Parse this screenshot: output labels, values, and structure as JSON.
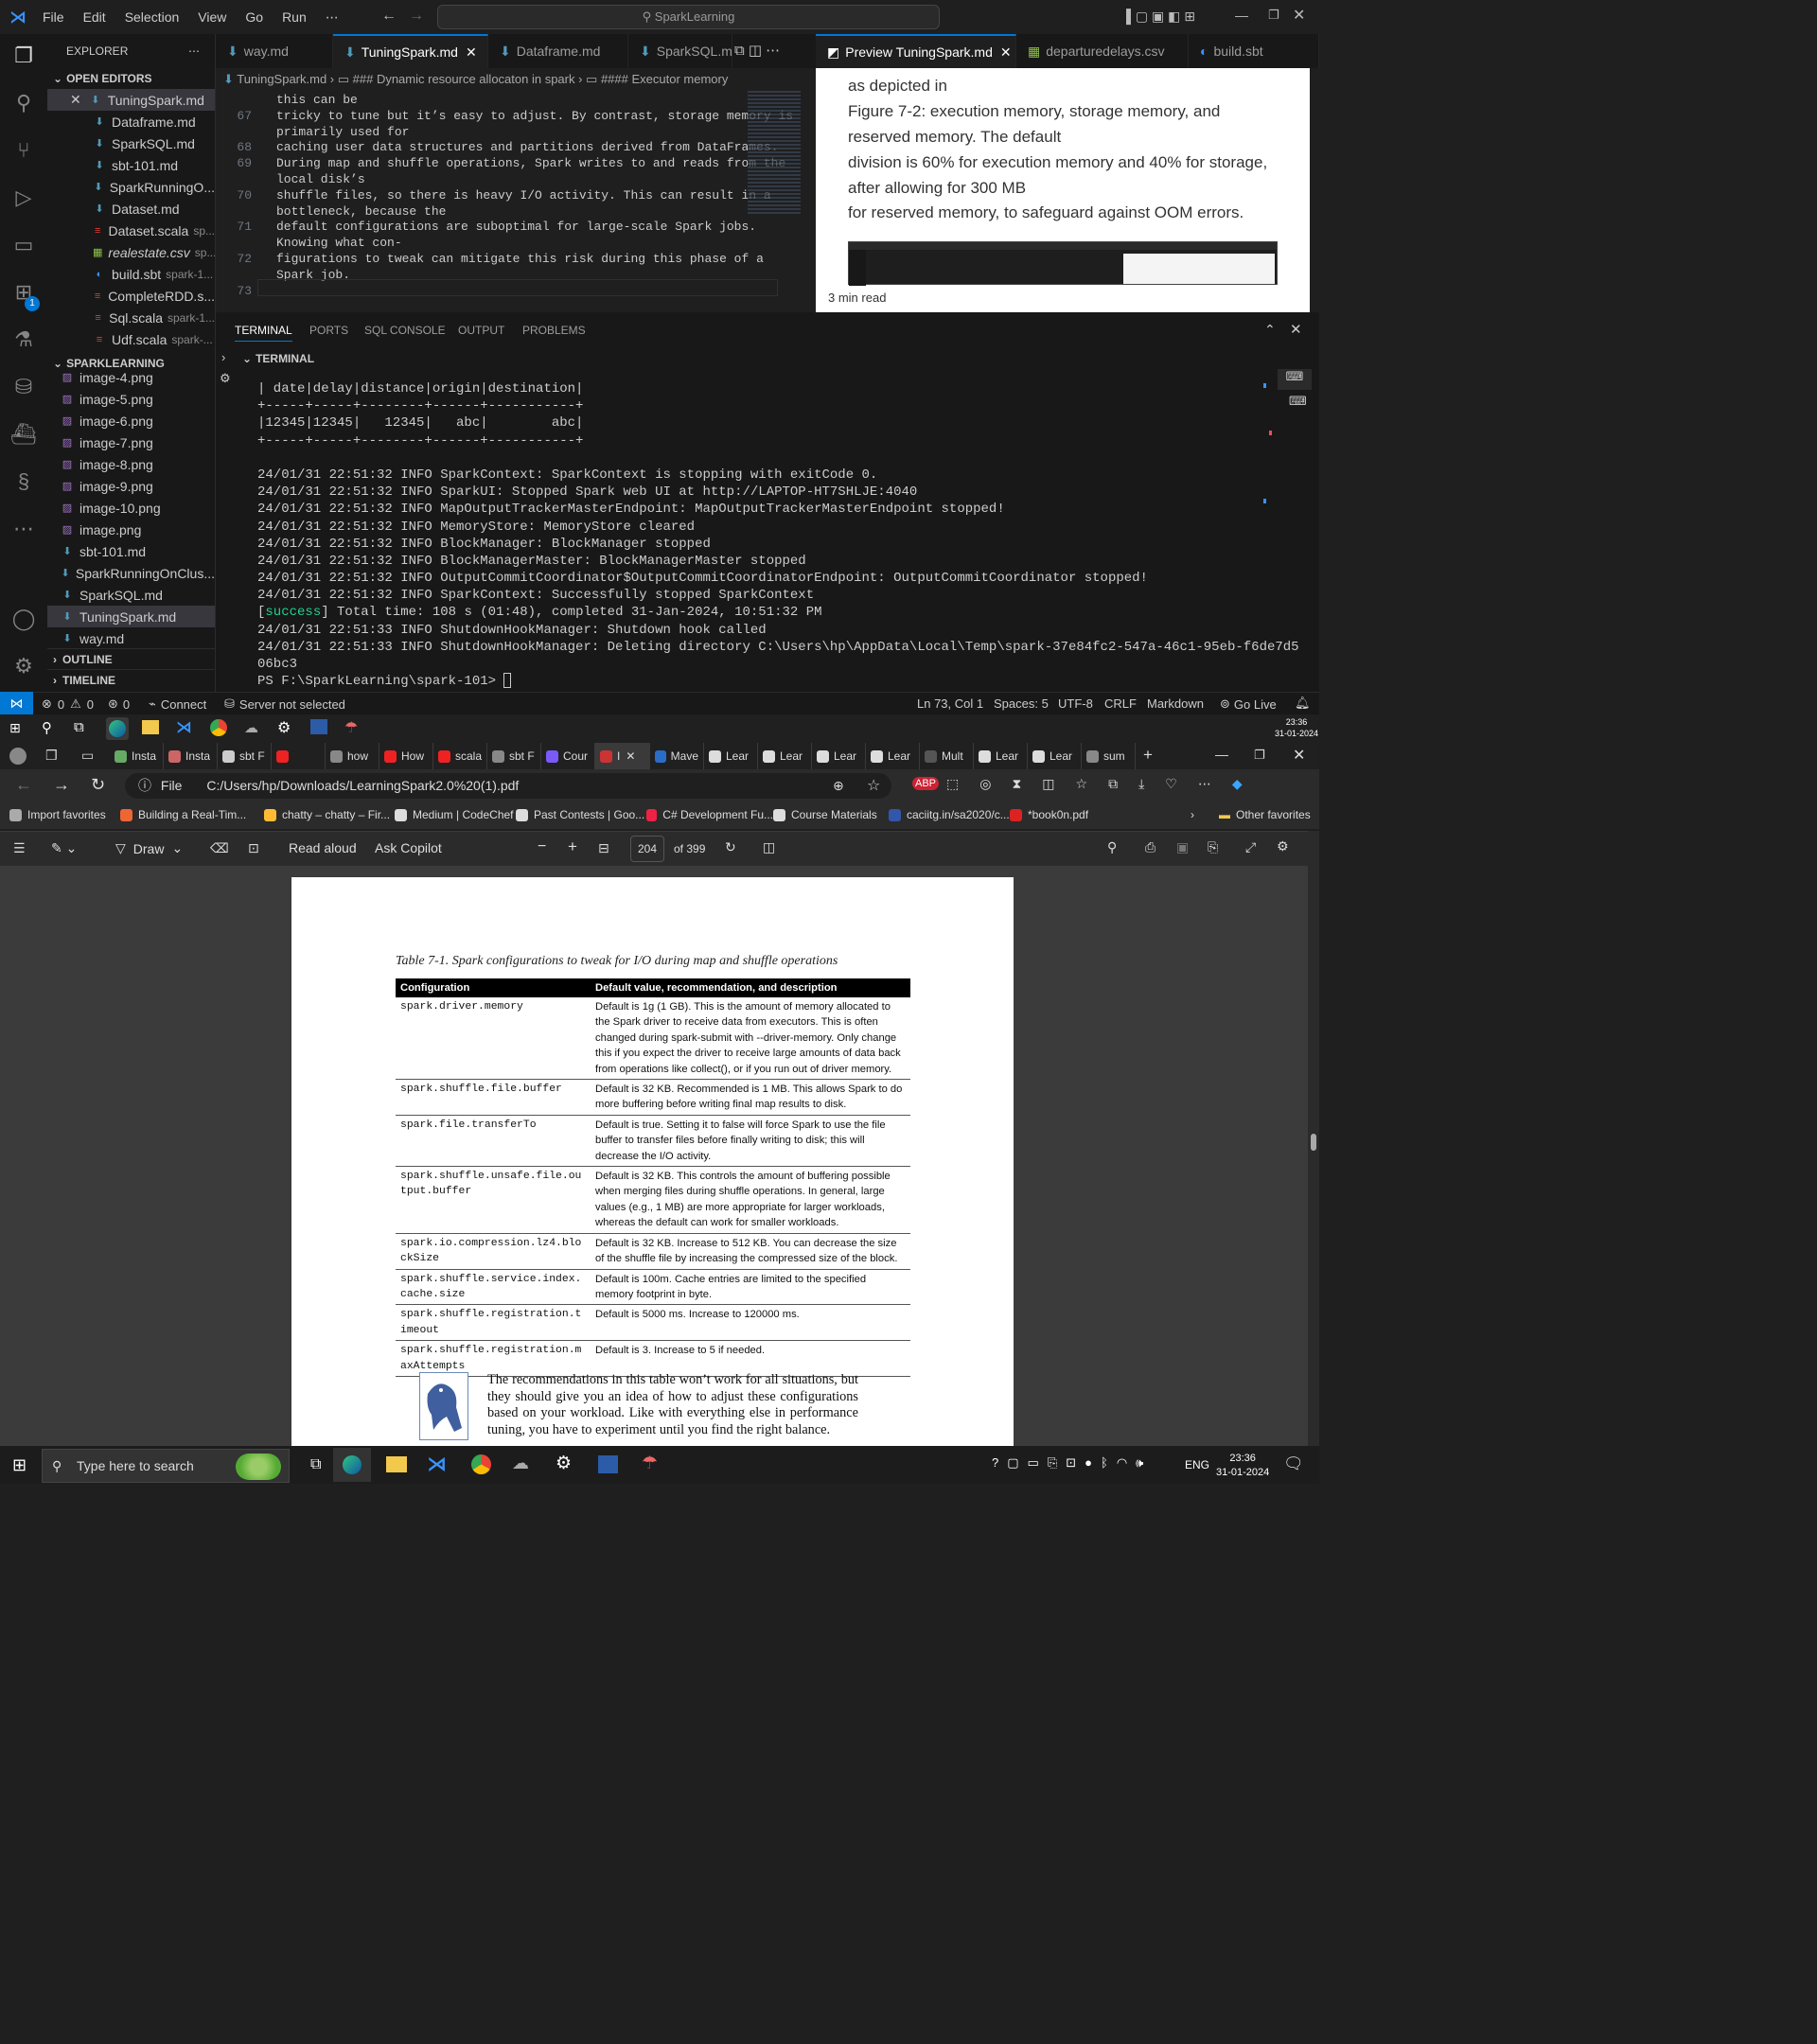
{
  "vscode": {
    "menu": [
      "File",
      "Edit",
      "Selection",
      "View",
      "Go",
      "Run",
      "⋯"
    ],
    "command_center": "SparkLearning",
    "explorer_title": "EXPLORER",
    "open_editors_label": "OPEN EDITORS",
    "open_editors": [
      {
        "name": "TuningSpark.md",
        "sub": "",
        "icon": "md"
      },
      {
        "name": "Dataframe.md",
        "sub": "",
        "icon": "md"
      },
      {
        "name": "SparkSQL.md",
        "sub": "",
        "icon": "md"
      },
      {
        "name": "sbt-101.md",
        "sub": "",
        "icon": "md"
      },
      {
        "name": "SparkRunningO...",
        "sub": "",
        "icon": "md"
      },
      {
        "name": "Dataset.md",
        "sub": "",
        "icon": "md"
      },
      {
        "name": "Dataset.scala",
        "sub": "sp...",
        "icon": "scala"
      },
      {
        "name": "realestate.csv",
        "sub": "sp...",
        "icon": "csv"
      },
      {
        "name": "build.sbt",
        "sub": "spark-1...",
        "icon": "sbt"
      },
      {
        "name": "CompleteRDD.s...",
        "sub": "",
        "icon": "scala"
      },
      {
        "name": "Sql.scala",
        "sub": "spark-1...",
        "icon": "scala"
      },
      {
        "name": "Udf.scala",
        "sub": "spark-...",
        "icon": "scala"
      }
    ],
    "workspace_label": "SPARKLEARNING",
    "files": [
      {
        "name": "image-4.png",
        "icon": "png"
      },
      {
        "name": "image-5.png",
        "icon": "png"
      },
      {
        "name": "image-6.png",
        "icon": "png"
      },
      {
        "name": "image-7.png",
        "icon": "png"
      },
      {
        "name": "image-8.png",
        "icon": "png"
      },
      {
        "name": "image-9.png",
        "icon": "png"
      },
      {
        "name": "image-10.png",
        "icon": "png"
      },
      {
        "name": "image.png",
        "icon": "png"
      },
      {
        "name": "sbt-101.md",
        "icon": "md"
      },
      {
        "name": "SparkRunningOnClus...",
        "icon": "md"
      },
      {
        "name": "SparkSQL.md",
        "icon": "md"
      },
      {
        "name": "TuningSpark.md",
        "icon": "md"
      },
      {
        "name": "way.md",
        "icon": "md"
      }
    ],
    "outline_label": "OUTLINE",
    "timeline_label": "TIMELINE",
    "editor_tabs": [
      "way.md",
      "TuningSpark.md",
      "Dataframe.md",
      "SparkSQL.m"
    ],
    "breadcrumb": [
      "TuningSpark.md",
      "### Dynamic resource allocaton in spark",
      "#### Executor memory"
    ],
    "code_lines": [
      {
        "n": "",
        "t": "this can be"
      },
      {
        "n": "67",
        "t": "tricky to tune but it’s easy to adjust. By contrast, storage memory is"
      },
      {
        "n": "",
        "t": "primarily used for"
      },
      {
        "n": "68",
        "t": "caching user data structures and partitions derived from DataFrames."
      },
      {
        "n": "69",
        "t": "During map and shuffle operations, Spark writes to and reads from the"
      },
      {
        "n": "",
        "t": "local disk’s"
      },
      {
        "n": "70",
        "t": "shuffle files, so there is heavy I/O activity. This can result in a"
      },
      {
        "n": "",
        "t": "bottleneck, because the"
      },
      {
        "n": "71",
        "t": "default configurations are suboptimal for large-scale Spark jobs."
      },
      {
        "n": "",
        "t": "Knowing what con-"
      },
      {
        "n": "72",
        "t": "figurations to tweak can mitigate this risk during this phase of a"
      },
      {
        "n": "",
        "t": "Spark job."
      },
      {
        "n": "73",
        "t": ""
      }
    ],
    "preview_tabs": [
      "Preview TuningSpark.md",
      "departuredelays.csv",
      "build.sbt"
    ],
    "preview_lines": [
      "as depicted in",
      "Figure 7-2: execution memory, storage memory, and",
      "reserved memory. The default",
      "division is 60% for execution memory and 40% for storage,",
      "after allowing for 300 MB",
      "for reserved memory, to safeguard against OOM errors."
    ],
    "preview_read": "3 min read",
    "panel_tabs": [
      "TERMINAL",
      "PORTS",
      "SQL CONSOLE",
      "OUTPUT",
      "PROBLEMS"
    ],
    "terminal_label": "TERMINAL",
    "terminal_lines": [
      "| date|delay|distance|origin|destination|",
      "+-----+-----+--------+------+-----------+",
      "|12345|12345|   12345|   abc|        abc|",
      "+-----+-----+--------+------+-----------+",
      "",
      "24/01/31 22:51:32 INFO SparkContext: SparkContext is stopping with exitCode 0.",
      "24/01/31 22:51:32 INFO SparkUI: Stopped Spark web UI at http://LAPTOP-HT7SHLJE:4040",
      "24/01/31 22:51:32 INFO MapOutputTrackerMasterEndpoint: MapOutputTrackerMasterEndpoint stopped!",
      "24/01/31 22:51:32 INFO MemoryStore: MemoryStore cleared",
      "24/01/31 22:51:32 INFO BlockManager: BlockManager stopped",
      "24/01/31 22:51:32 INFO BlockManagerMaster: BlockManagerMaster stopped",
      "24/01/31 22:51:32 INFO OutputCommitCoordinator$OutputCommitCoordinatorEndpoint: OutputCommitCoordinator stopped!",
      "24/01/31 22:51:32 INFO SparkContext: Successfully stopped SparkContext"
    ],
    "success_word": "success",
    "success_rest": "] Total time: 108 s (01:48), completed 31-Jan-2024, 10:51:32 PM",
    "terminal_tail": [
      "24/01/31 22:51:33 INFO ShutdownHookManager: Shutdown hook called",
      "24/01/31 22:51:33 INFO ShutdownHookManager: Deleting directory C:\\Users\\hp\\AppData\\Local\\Temp\\spark-37e84fc2-547a-46c1-95eb-f6de7d5",
      "06bc3",
      "PS F:\\SparkLearning\\spark-101> "
    ],
    "status": {
      "errors": "0",
      "warnings": "0",
      "ports": "0",
      "connect": "Connect",
      "server": "Server not selected",
      "position": "Ln 73, Col 1",
      "spaces": "Spaces: 5",
      "encoding": "UTF-8",
      "eol": "CRLF",
      "language": "Markdown",
      "golive": "Go Live"
    },
    "accounts_badge": "1"
  },
  "windows_top": {
    "time": "23:36",
    "date": "31-01-2024"
  },
  "edge": {
    "tabs": [
      "Insta",
      "Insta",
      "sbt F",
      "",
      "how",
      "How",
      "scala",
      "sbt F",
      "Cour",
      "I",
      "Mave",
      "Lear",
      "Lear",
      "Lear",
      "Lear",
      "Mult",
      "Lear",
      "Lear",
      "sum"
    ],
    "address_prefix": "File",
    "address": "C:/Users/hp/Downloads/LearningSpark2.0%20(1).pdf",
    "favorites": [
      "Import favorites",
      "Building a Real-Tim...",
      "chatty – chatty – Fir...",
      "Medium | CodeChef",
      "Past Contests | Goo...",
      "C# Development Fu...",
      "Course Materials",
      "caciitg.in/sa2020/c...",
      "*book0n.pdf"
    ],
    "other_favorites": "Other favorites",
    "pdf_toolbar": {
      "draw": "Draw",
      "read_aloud": "Read aloud",
      "ask_copilot": "Ask Copilot",
      "page": "204",
      "of": "of 399"
    }
  },
  "pdf": {
    "caption": "Table 7-1. Spark configurations to tweak for I/O during map and shuffle operations",
    "headers": [
      "Configuration",
      "Default value, recommendation, and description"
    ],
    "rows": [
      {
        "k": "spark.driver.memory",
        "v": "Default is 1g (1 GB). This is the amount of memory allocated to the Spark driver to receive data from executors. This is often changed during spark-submit with --driver-memory. Only change this if you expect the driver to receive large amounts of data back from operations like collect(), or if you run out of driver memory."
      },
      {
        "k": "spark.shuffle.file.buffer",
        "v": "Default is 32 KB. Recommended is 1 MB. This allows Spark to do more buffering before writing final map results to disk."
      },
      {
        "k": "spark.file.transferTo",
        "v": "Default is true. Setting it to false will force Spark to use the file buffer to transfer files before finally writing to disk; this will decrease the I/O activity."
      },
      {
        "k": "spark.shuffle.unsafe.file.output.buffer",
        "v": "Default is 32 KB. This controls the amount of buffering possible when merging files during shuffle operations. In general, large values (e.g., 1 MB) are more appropriate for larger workloads, whereas the default can work for smaller workloads."
      },
      {
        "k": "spark.io.compression.lz4.blockSize",
        "v": "Default is 32 KB. Increase to 512 KB. You can decrease the size of the shuffle file by increasing the compressed size of the block."
      },
      {
        "k": "spark.shuffle.service.index.cache.size",
        "v": "Default is 100m. Cache entries are limited to the specified memory footprint in byte."
      },
      {
        "k": "spark.shuffle.registration.timeout",
        "v": "Default is 5000 ms. Increase to 120000 ms."
      },
      {
        "k": "spark.shuffle.registration.maxAttempts",
        "v": "Default is 3. Increase to 5 if needed."
      }
    ],
    "note": "The recommendations in this table won’t work for all situations, but they should give you an idea of how to adjust these configurations based on your workload. Like with everything else in performance tuning, you have to experiment until you find the right balance."
  },
  "taskbar": {
    "search_placeholder": "Type here to search",
    "lang": "ENG",
    "time": "23:36",
    "date": "31-01-2024"
  },
  "colors": {
    "accent": "#0078d4",
    "success": "#23d18b",
    "md_icon": "#519aba",
    "scala_icon": "#e03b3b",
    "csv_icon": "#8dc149"
  }
}
